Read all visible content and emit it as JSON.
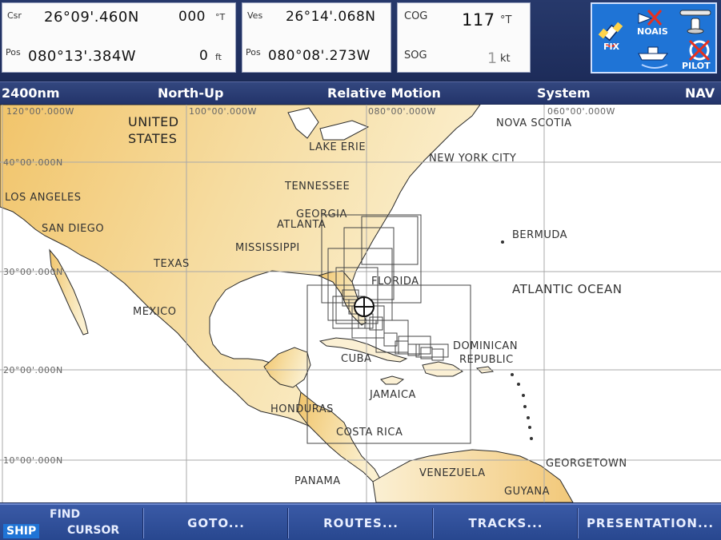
{
  "top_panels": {
    "cursor": {
      "csr_label": "Csr",
      "csr_lat": "26°09'.460N",
      "csr_bearing": "000",
      "csr_bearing_unit": "°T",
      "pos_label": "Pos",
      "pos_lon": "080°13'.384W",
      "pos_range": "0",
      "pos_range_unit": "ft"
    },
    "vessel": {
      "ves_label": "Ves",
      "ves_lat": "26°14'.068N",
      "pos_label": "Pos",
      "pos_lon": "080°08'.273W"
    },
    "motion": {
      "cog_label": "COG",
      "cog_value": "117",
      "cog_unit": "°T",
      "sog_label": "SOG",
      "sog_value": "1",
      "sog_unit": "kt"
    },
    "icons": {
      "fix_label": "FIX",
      "noais_label": "NOAIS",
      "pilot_label": "PILOT"
    }
  },
  "header": {
    "range": "2400nm",
    "orientation": "North-Up",
    "motion_mode": "Relative Motion",
    "system": "System",
    "nav": "NAV"
  },
  "map": {
    "grid_labels": {
      "lon_120": "120°00'.000W",
      "lon_100": "100°00'.000W",
      "lon_080": "080°00'.000W",
      "lon_060": "060°00'.000W",
      "lat_40": "40°00'.000N",
      "lat_30": "30°00'.000N",
      "lat_20": "20°00'.000N",
      "lat_10": "10°00'.000N"
    },
    "labels": {
      "united": "UNITED",
      "states": "STATES",
      "lake_erie": "LAKE ERIE",
      "nova_scotia": "NOVA SCOTIA",
      "new_york": "NEW YORK CITY",
      "los_angeles": "LOS ANGELES",
      "tennessee": "TENNESSEE",
      "georgia": "GEORGIA",
      "atlanta": "ATLANTA",
      "san_diego": "SAN DIEGO",
      "bermuda": "BERMUDA",
      "mississippi": "MISSISSIPPI",
      "texas": "TEXAS",
      "florida": "FLORIDA",
      "atlantic": "ATLANTIC OCEAN",
      "mexico": "MEXICO",
      "dominican": "DOMINICAN",
      "republic": "REPUBLIC",
      "cuba": "CUBA",
      "jamaica": "JAMAICA",
      "honduras": "HONDURAS",
      "costa_rica": "COSTA RICA",
      "georgetown": "GEORGETOWN",
      "venezuela": "VENEZUELA",
      "panama": "PANAMA",
      "guyana": "GUYANA"
    }
  },
  "softkeys": {
    "ship": "SHIP",
    "find": "FIND",
    "cursor": "CURSOR",
    "goto": "GOTO...",
    "routes": "ROUTES...",
    "tracks": "TRACKS...",
    "presentation": "PRESENTATION..."
  },
  "colors": {
    "land_light": "#fbeec4",
    "land_dark": "#ecb451",
    "water": "#ffffff",
    "panel_bg": "#fbfbfb",
    "bar_bg": "#23346a",
    "icon_bg": "#1f74d6"
  }
}
